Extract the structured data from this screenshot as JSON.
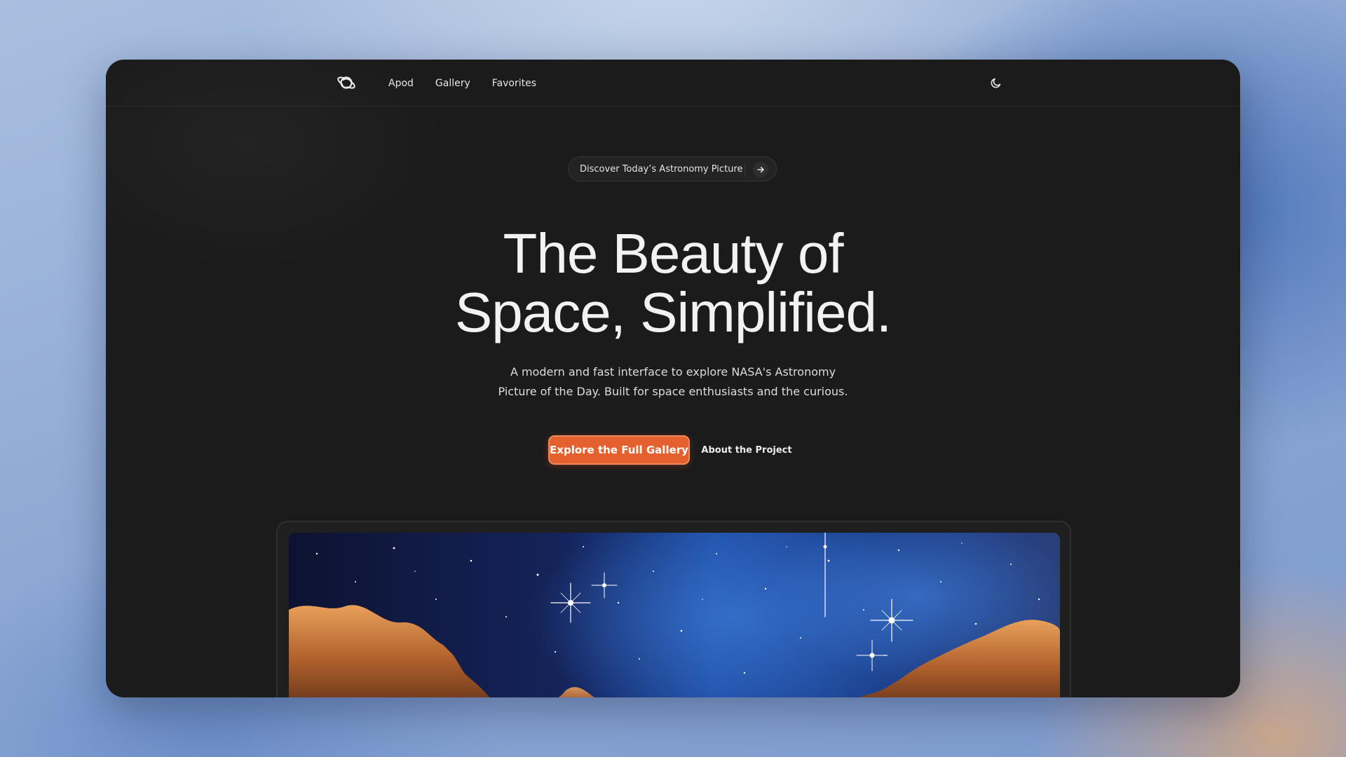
{
  "nav": {
    "logo_icon": "planet-icon",
    "links": [
      "Apod",
      "Gallery",
      "Favorites"
    ],
    "theme_icon": "moon-icon"
  },
  "announcement": {
    "text": "Discover Today’s Astronomy Picture",
    "icon": "arrow-right-icon"
  },
  "hero": {
    "title_line1": "The Beauty of",
    "title_line2": "Space, Simplified.",
    "subtitle_line1": "A modern and fast interface to explore NASA's Astronomy",
    "subtitle_line2": "Picture of the Day. Built for space enthusiasts and the curious."
  },
  "actions": {
    "primary_label": "Explore the Full Gallery",
    "secondary_label": "About the Project"
  },
  "colors": {
    "window_bg": "#1b1b1b",
    "accent": "#e4602f",
    "text": "#f2f2f2"
  }
}
